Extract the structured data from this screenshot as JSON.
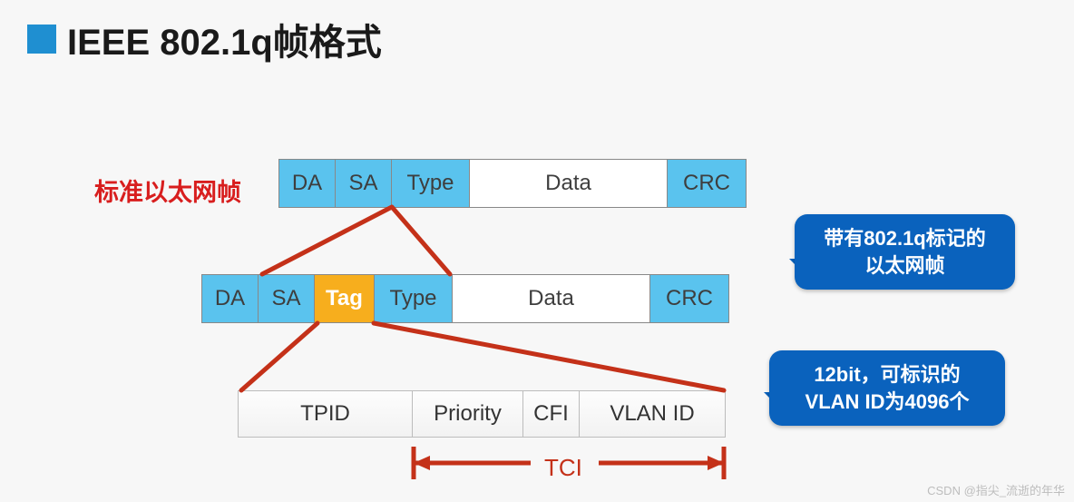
{
  "title": "IEEE 802.1q帧格式",
  "standard_label": "标准以太网帧",
  "row1": {
    "da": "DA",
    "sa": "SA",
    "type": "Type",
    "data": "Data",
    "crc": "CRC"
  },
  "row2": {
    "da": "DA",
    "sa": "SA",
    "tag": "Tag",
    "type": "Type",
    "data": "Data",
    "crc": "CRC"
  },
  "row3": {
    "tpid": "TPID",
    "priority": "Priority",
    "cfi": "CFI",
    "vlanid": "VLAN ID"
  },
  "callout1_line1": "带有802.1q标记的",
  "callout1_line2": "以太网帧",
  "callout2_line1": "12bit，可标识的",
  "callout2_line2": "VLAN ID为4096个",
  "tci": "TCI",
  "watermark": "CSDN @指尖_流逝的年华",
  "colors": {
    "bullet": "#1f8fd1",
    "frame_blue": "#5ac3ee",
    "tag_orange": "#f7ae1d",
    "callout_blue": "#0a62bd",
    "connector_red": "#c43119",
    "std_label_red": "#d81e1e"
  },
  "chart_data": {
    "type": "diagram",
    "title": "IEEE 802.1q Frame Format",
    "frames": [
      {
        "name": "Standard Ethernet Frame",
        "fields": [
          "DA",
          "SA",
          "Type",
          "Data",
          "CRC"
        ]
      },
      {
        "name": "802.1q Tagged Ethernet Frame",
        "fields": [
          "DA",
          "SA",
          "Tag",
          "Type",
          "Data",
          "CRC"
        ]
      }
    ],
    "tag_subfields": {
      "TPID": null,
      "TCI": {
        "Priority": null,
        "CFI": null,
        "VLAN ID": {
          "bits": 12,
          "identifiable_vlans": 4096
        }
      }
    }
  }
}
